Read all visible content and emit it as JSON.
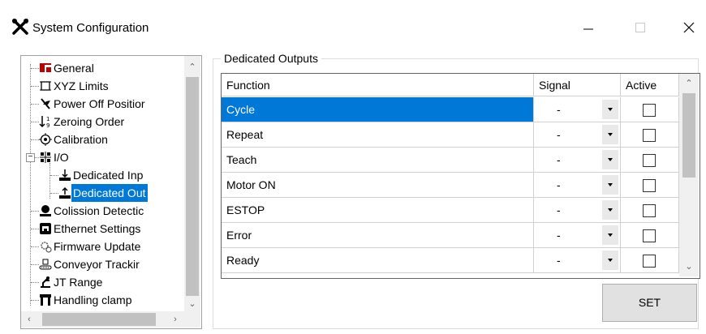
{
  "window": {
    "title": "System Configuration",
    "app_icon": "tools-icon",
    "controls": {
      "minimize_icon": "minimize-icon",
      "maximize_icon": "maximize-icon",
      "close_icon": "close-icon"
    }
  },
  "tree": {
    "items": [
      {
        "label": "General",
        "icon": "general-icon"
      },
      {
        "label": "XYZ Limits",
        "icon": "xyz-limits-icon"
      },
      {
        "label": "Power Off Positior",
        "icon": "power-off-icon"
      },
      {
        "label": "Zeroing Order",
        "icon": "zeroing-order-icon"
      },
      {
        "label": "Calibration",
        "icon": "calibration-icon"
      },
      {
        "label": "I/O",
        "icon": "io-icon",
        "expanded": true
      },
      {
        "label": "Dedicated Inp",
        "icon": "dedicated-input-icon"
      },
      {
        "label": "Dedicated Out",
        "icon": "dedicated-output-icon",
        "selected": true
      },
      {
        "label": "Colission Detectic",
        "icon": "collision-detection-icon"
      },
      {
        "label": "Ethernet Settings",
        "icon": "ethernet-icon"
      },
      {
        "label": "Firmware Update",
        "icon": "firmware-update-icon"
      },
      {
        "label": "Conveyor Trackir",
        "icon": "conveyor-tracking-icon"
      },
      {
        "label": "JT Range",
        "icon": "jt-range-icon"
      },
      {
        "label": "Handling clamp",
        "icon": "handling-clamp-icon"
      }
    ],
    "expander_symbol": "−"
  },
  "outputs": {
    "group_title": "Dedicated Outputs",
    "columns": {
      "function": "Function",
      "signal": "Signal",
      "active": "Active"
    },
    "rows": [
      {
        "function": "Cycle",
        "signal": "-",
        "active": false,
        "selected": true
      },
      {
        "function": "Repeat",
        "signal": "-",
        "active": false
      },
      {
        "function": "Teach",
        "signal": "-",
        "active": false
      },
      {
        "function": "Motor ON",
        "signal": "-",
        "active": false
      },
      {
        "function": "ESTOP",
        "signal": "-",
        "active": false
      },
      {
        "function": "Error",
        "signal": "-",
        "active": false
      },
      {
        "function": "Ready",
        "signal": "-",
        "active": false
      }
    ]
  },
  "set_button": {
    "label": "SET"
  },
  "colors": {
    "selection": "#0078d7",
    "button_face": "#e1e1e1",
    "scroll_track": "#f0f0f0",
    "scroll_thumb": "#c1c1c1"
  }
}
